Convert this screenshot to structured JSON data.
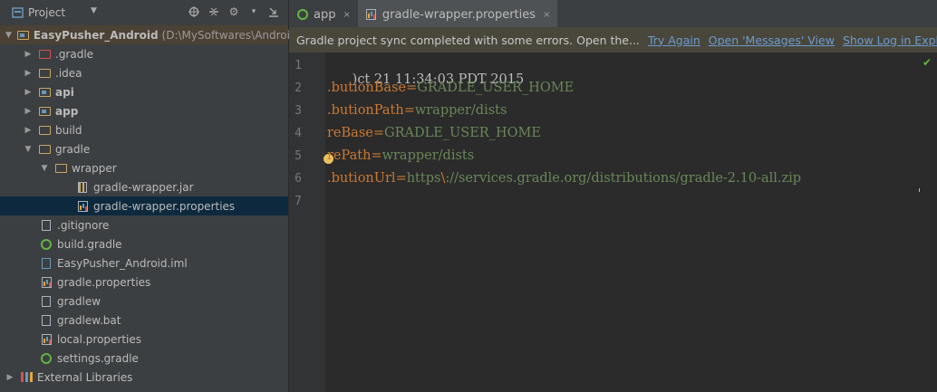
{
  "sidebar": {
    "header": {
      "label": "Project"
    },
    "tree": [
      {
        "label": "EasyPusher_Android",
        "path": "(D:\\MySoftwares\\Android"
      },
      {
        "label": ".gradle"
      },
      {
        "label": ".idea"
      },
      {
        "label": "api"
      },
      {
        "label": "app"
      },
      {
        "label": "build"
      },
      {
        "label": "gradle"
      },
      {
        "label": "wrapper"
      },
      {
        "label": "gradle-wrapper.jar"
      },
      {
        "label": "gradle-wrapper.properties"
      },
      {
        "label": ".gitignore"
      },
      {
        "label": "build.gradle"
      },
      {
        "label": "EasyPusher_Android.iml"
      },
      {
        "label": "gradle.properties"
      },
      {
        "label": "gradlew"
      },
      {
        "label": "gradlew.bat"
      },
      {
        "label": "local.properties"
      },
      {
        "label": "settings.gradle"
      },
      {
        "label": "External Libraries"
      }
    ]
  },
  "tabs": [
    {
      "label": "app",
      "close": "×"
    },
    {
      "label": "gradle-wrapper.properties",
      "close": "×"
    }
  ],
  "notification": {
    "message": "Gradle project sync completed with some errors. Open the...",
    "links": [
      "Try Again",
      "Open 'Messages' View",
      "Show Log in Explorer"
    ]
  },
  "editor": {
    "line_numbers": [
      "1",
      "2",
      "3",
      "4",
      "5",
      "6",
      "7"
    ],
    "lines": [
      {
        "comment": ")ct 21 11:34:03 PDT 2015"
      },
      {
        "key": ".butionBase",
        "eq": "=",
        "value": "GRADLE_USER_HOME"
      },
      {
        "key": ".butionPath",
        "eq": "=",
        "value": "wrapper/dists"
      },
      {
        "key": "reBase",
        "eq": "=",
        "value": "GRADLE_USER_HOME"
      },
      {
        "key": "rePath",
        "eq": "=",
        "value": "wrapper/dists"
      },
      {
        "key": ".butionUrl",
        "eq": "=",
        "value_a": "https",
        "esc": "\\",
        "value_b": "://services.gradle.org/distributions/gradle-2.10-all.zip"
      },
      {}
    ],
    "status_icon": "check-icon"
  }
}
